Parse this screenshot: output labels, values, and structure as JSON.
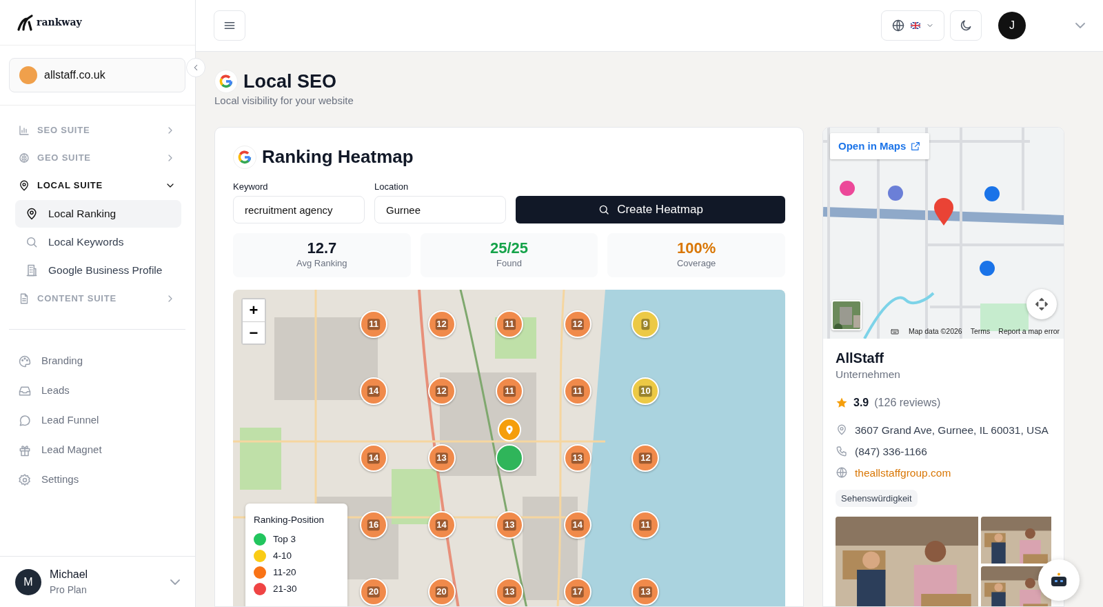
{
  "sidebar": {
    "logo": "rankway",
    "workspace": {
      "name": "allstaff.co.uk"
    },
    "sections": [
      {
        "label": "SEO SUITE",
        "expanded": false
      },
      {
        "label": "GEO SUITE",
        "expanded": false
      },
      {
        "label": "LOCAL SUITE",
        "expanded": true,
        "children": [
          {
            "label": "Local Ranking",
            "selected": true
          },
          {
            "label": "Local Keywords",
            "selected": false
          },
          {
            "label": "Google Business Profile",
            "selected": false
          }
        ]
      },
      {
        "label": "CONTENT SUITE",
        "expanded": false
      }
    ],
    "links": [
      {
        "label": "Branding"
      },
      {
        "label": "Leads"
      },
      {
        "label": "Lead Funnel"
      },
      {
        "label": "Lead Magnet"
      },
      {
        "label": "Settings"
      }
    ],
    "user": {
      "initial": "M",
      "name": "Michael",
      "plan": "Pro Plan"
    }
  },
  "topbar": {
    "avatar_initial": "J"
  },
  "page": {
    "title": "Local SEO",
    "subtitle": "Local visibility for your website"
  },
  "heatmap": {
    "title": "Ranking Heatmap",
    "fields": [
      {
        "label": "Keyword",
        "value": "recruitment agency"
      },
      {
        "label": "Location",
        "value": "Gurnee"
      }
    ],
    "button": "Create Heatmap",
    "stats": [
      {
        "value": "12.7",
        "label": "Avg Ranking",
        "color": "#111827"
      },
      {
        "value": "25/25",
        "label": "Found",
        "color": "#16a34a"
      },
      {
        "value": "100%",
        "label": "Coverage",
        "color": "#d97706"
      }
    ],
    "zoom": [
      "+",
      "−"
    ],
    "legend": {
      "title": "Ranking-Position",
      "items": [
        {
          "label": "Top 3",
          "color": "#22c55e"
        },
        {
          "label": "4-10",
          "color": "#facc15"
        },
        {
          "label": "11-20",
          "color": "#f97316"
        },
        {
          "label": "21-30",
          "color": "#ef4444"
        }
      ]
    },
    "markers": [
      {
        "kind": "rank",
        "rank": "11",
        "color": "#f08a4b"
      },
      {
        "kind": "rank",
        "rank": "12",
        "color": "#f08a4b"
      },
      {
        "kind": "rank",
        "rank": "11",
        "color": "#f08a4b"
      },
      {
        "kind": "rank",
        "rank": "12",
        "color": "#f08a4b"
      },
      {
        "kind": "rank",
        "rank": "9",
        "color": "#ecc945"
      },
      {
        "kind": "rank",
        "rank": "14",
        "color": "#f08a4b"
      },
      {
        "kind": "rank",
        "rank": "12",
        "color": "#f08a4b"
      },
      {
        "kind": "rank",
        "rank": "11",
        "color": "#f08a4b"
      },
      {
        "kind": "rank",
        "rank": "11",
        "color": "#f08a4b"
      },
      {
        "kind": "rank",
        "rank": "10",
        "color": "#ecc945"
      },
      {
        "kind": "rank",
        "rank": "14",
        "color": "#f08a4b"
      },
      {
        "kind": "rank",
        "rank": "13",
        "color": "#f08a4b"
      },
      {
        "kind": "center",
        "color": "#2fb55a"
      },
      {
        "kind": "rank",
        "rank": "13",
        "color": "#f08a4b"
      },
      {
        "kind": "rank",
        "rank": "12",
        "color": "#f08a4b"
      },
      {
        "kind": "rank",
        "rank": "16",
        "color": "#f08a4b"
      },
      {
        "kind": "rank",
        "rank": "14",
        "color": "#f08a4b"
      },
      {
        "kind": "rank",
        "rank": "13",
        "color": "#f08a4b"
      },
      {
        "kind": "rank",
        "rank": "14",
        "color": "#f08a4b"
      },
      {
        "kind": "rank",
        "rank": "11",
        "color": "#f08a4b"
      },
      {
        "kind": "rank",
        "rank": "20",
        "color": "#f08a4b"
      },
      {
        "kind": "rank",
        "rank": "20",
        "color": "#f08a4b"
      },
      {
        "kind": "rank",
        "rank": "13",
        "color": "#f08a4b"
      },
      {
        "kind": "rank",
        "rank": "17",
        "color": "#f08a4b"
      },
      {
        "kind": "rank",
        "rank": "13",
        "color": "#f08a4b"
      }
    ]
  },
  "business": {
    "open_maps": "Open in Maps",
    "attribution": [
      "Map data ©2026",
      "Terms",
      "Report a map error"
    ],
    "name": "AllStaff",
    "category": "Unternehmen",
    "rating": "3.9",
    "reviews": "(126 reviews)",
    "address": "3607 Grand Ave, Gurnee, IL 60031, USA",
    "phone": "(847) 336-1166",
    "website": "theallstaffgroup.com",
    "tag": "Sehenswürdigkeit",
    "photos": [
      {
        "kind": "picture"
      },
      {
        "kind": "picture"
      },
      {
        "kind": "picture"
      }
    ]
  }
}
